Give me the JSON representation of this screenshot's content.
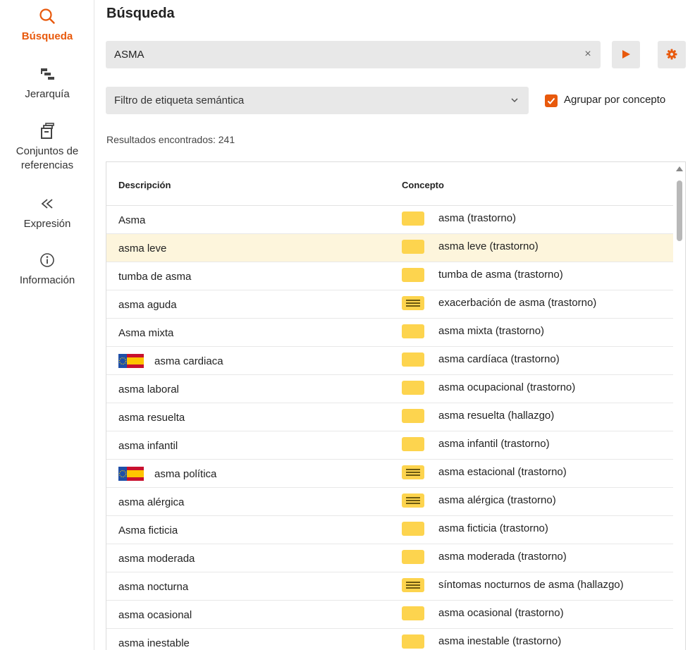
{
  "nav": {
    "items": [
      {
        "label": "Búsqueda",
        "icon": "search-icon"
      },
      {
        "label": "Jerarquía",
        "icon": "hierarchy-icon"
      },
      {
        "label": "Conjuntos de referencias",
        "icon": "archive-box-icon"
      },
      {
        "label": "Expresión",
        "icon": "double-chevron-left-icon"
      },
      {
        "label": "Información",
        "icon": "info-circle-icon"
      }
    ],
    "active": "Búsqueda"
  },
  "page": {
    "title": "Búsqueda"
  },
  "search": {
    "value": "ASMA",
    "clear": "×"
  },
  "filter": {
    "label": "Filtro de etiqueta semántica"
  },
  "group_by_concept": {
    "label": "Agrupar por concepto",
    "checked": true
  },
  "results": {
    "count_text": "Resultados encontrados: 241"
  },
  "table": {
    "headers": {
      "description": "Descripción",
      "concept": "Concepto"
    },
    "rows": [
      {
        "description": "Asma",
        "concept": "asma (trastorno)",
        "concept_icon": "primitive",
        "flag": false,
        "highlight": false
      },
      {
        "description": "asma leve",
        "concept": "asma leve (trastorno)",
        "concept_icon": "primitive",
        "flag": false,
        "highlight": true
      },
      {
        "description": "tumba de asma",
        "concept": "tumba de asma (trastorno)",
        "concept_icon": "primitive",
        "flag": false,
        "highlight": false
      },
      {
        "description": "asma aguda",
        "concept": "exacerbación de asma (trastorno)",
        "concept_icon": "defined",
        "flag": false,
        "highlight": false
      },
      {
        "description": "Asma mixta",
        "concept": "asma mixta (trastorno)",
        "concept_icon": "primitive",
        "flag": false,
        "highlight": false
      },
      {
        "description": "asma cardiaca",
        "concept": "asma cardíaca (trastorno)",
        "concept_icon": "primitive",
        "flag": true,
        "highlight": false
      },
      {
        "description": "asma laboral",
        "concept": "asma ocupacional (trastorno)",
        "concept_icon": "primitive",
        "flag": false,
        "highlight": false
      },
      {
        "description": "asma resuelta",
        "concept": "asma resuelta (hallazgo)",
        "concept_icon": "primitive",
        "flag": false,
        "highlight": false
      },
      {
        "description": "asma infantil",
        "concept": "asma infantil (trastorno)",
        "concept_icon": "primitive",
        "flag": false,
        "highlight": false
      },
      {
        "description": "asma política",
        "concept": "asma estacional (trastorno)",
        "concept_icon": "defined",
        "flag": true,
        "highlight": false
      },
      {
        "description": "asma alérgica",
        "concept": "asma alérgica (trastorno)",
        "concept_icon": "defined",
        "flag": false,
        "highlight": false
      },
      {
        "description": "Asma ficticia",
        "concept": "asma ficticia (trastorno)",
        "concept_icon": "primitive",
        "flag": false,
        "highlight": false
      },
      {
        "description": "asma moderada",
        "concept": "asma moderada (trastorno)",
        "concept_icon": "primitive",
        "flag": false,
        "highlight": false
      },
      {
        "description": "asma nocturna",
        "concept": "síntomas nocturnos de asma (hallazgo)",
        "concept_icon": "defined",
        "flag": false,
        "highlight": false
      },
      {
        "description": "asma ocasional",
        "concept": "asma ocasional (trastorno)",
        "concept_icon": "primitive",
        "flag": false,
        "highlight": false
      },
      {
        "description": "asma inestable",
        "concept": "asma inestable (trastorno)",
        "concept_icon": "primitive",
        "flag": false,
        "highlight": false
      }
    ]
  },
  "colors": {
    "accent": "#e8590c",
    "highlight_row": "#fdf5dc",
    "concept_icon": "#fdd44e",
    "input_bg": "#e8e8e8"
  }
}
